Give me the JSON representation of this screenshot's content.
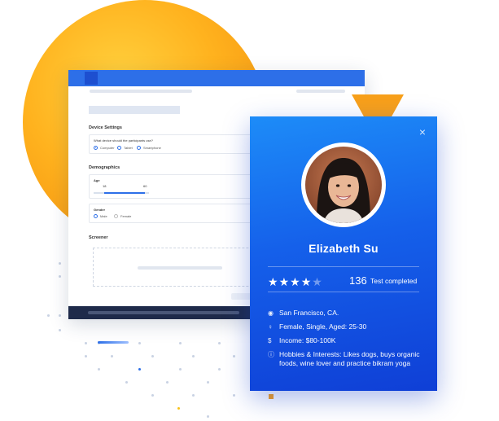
{
  "settings_window": {
    "device_settings_title": "Device Settings",
    "device_question": "What device should the participants use?",
    "device_options": [
      "Computer",
      "Tablet",
      "Smartphone"
    ],
    "device_selected": "Computer",
    "demographics_title": "Demographics",
    "age_label": "Age",
    "age_min_value": "18",
    "age_max_value": "60",
    "gender_label": "Gender",
    "gender_options": [
      "Male",
      "Female"
    ],
    "screener_title": "Screener"
  },
  "profile": {
    "name": "Elizabeth Su",
    "rating": 4,
    "rating_max": 5,
    "tests_completed": "136",
    "tests_completed_label": "Test completed",
    "details": [
      {
        "icon": "location-pin-icon",
        "text": "San Francisco, CA."
      },
      {
        "icon": "female-icon",
        "text": "Female, Single, Aged: 25-30"
      },
      {
        "icon": "dollar-icon",
        "text": "Income: $80-100K"
      },
      {
        "icon": "info-icon",
        "text": "Hobbies & Interests: Likes dogs, buys organic foods, wine lover and practice bikram yoga"
      }
    ],
    "close_symbol": "×",
    "colors": {
      "card_top": "#1d8cf8",
      "card_bottom": "#0f3fd6",
      "accent_orange": "#f8a01a"
    }
  }
}
